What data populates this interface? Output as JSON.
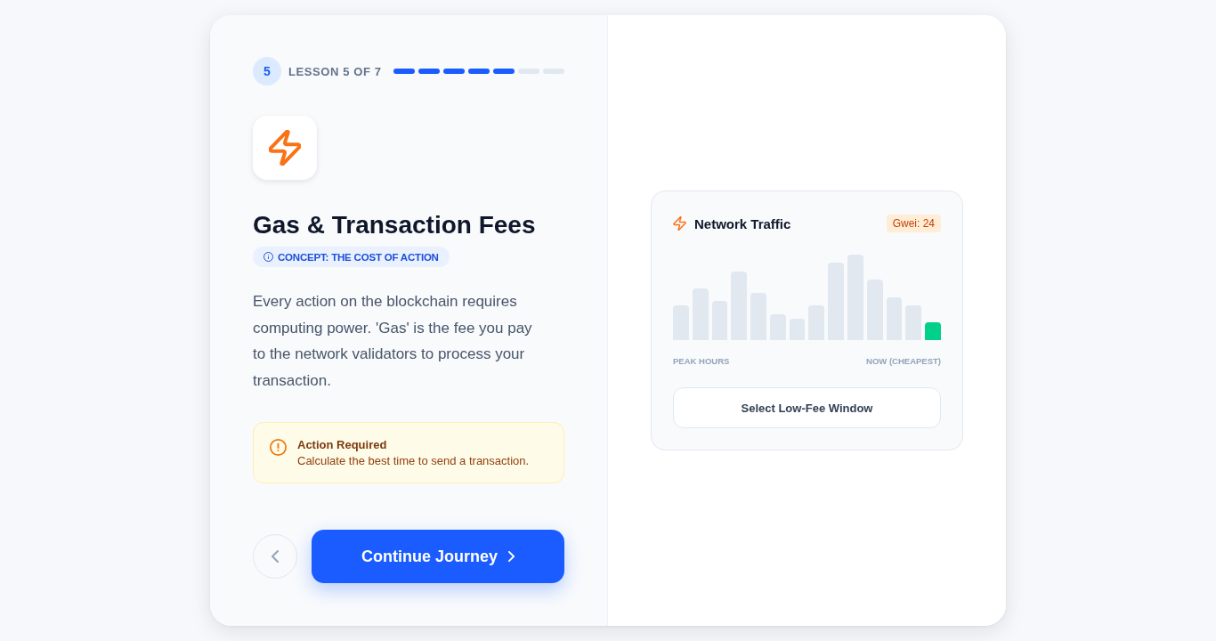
{
  "lesson": {
    "number": "5",
    "label": "LESSON 5 OF 7",
    "progress": [
      {
        "completed": true
      },
      {
        "completed": true
      },
      {
        "completed": true
      },
      {
        "completed": true
      },
      {
        "completed": true
      },
      {
        "completed": false
      },
      {
        "completed": false
      }
    ]
  },
  "title": "Gas & Transaction Fees",
  "concept_badge": "CONCEPT: THE COST OF ACTION",
  "description": "Every action on the blockchain requires computing power. 'Gas' is the fee you pay to the network validators to process your transaction.",
  "alert": {
    "title": "Action Required",
    "message": "Calculate the best time to send a transaction."
  },
  "nav": {
    "continue_button": "Continue Journey"
  },
  "traffic_card": {
    "title": "Network Traffic",
    "gwei_badge": "Gwei: 24",
    "start_label": "PEAK HOURS",
    "end_label": "NOW (CHEAPEST)",
    "button": "Select Low-Fee Window"
  }
}
